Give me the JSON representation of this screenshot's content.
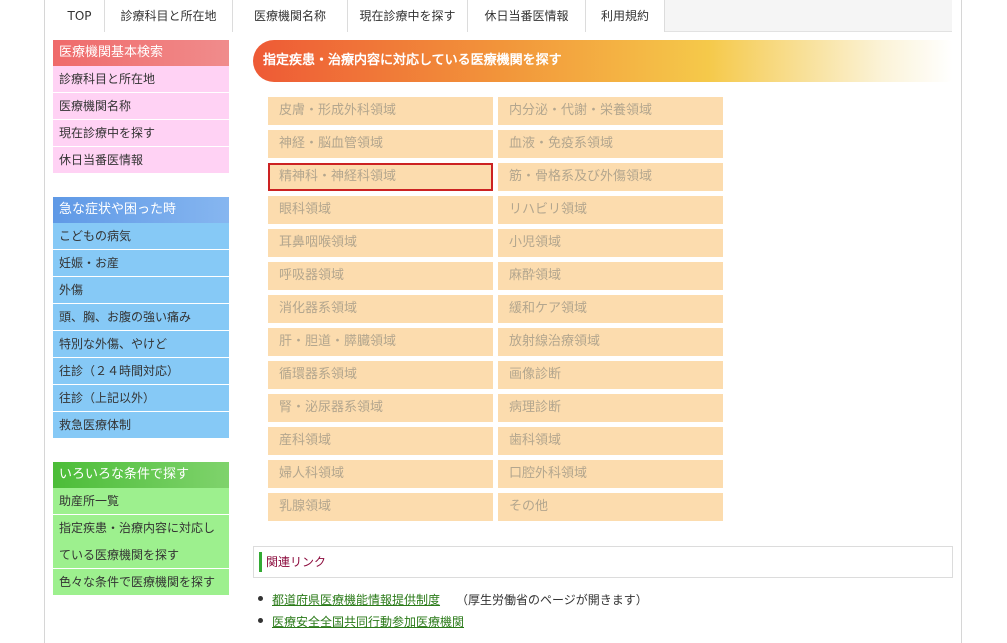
{
  "topnav": {
    "items": [
      "TOP",
      "診療科目と所在地",
      "医療機関名称",
      "現在診療中を探す",
      "休日当番医情報",
      "利用規約"
    ]
  },
  "sidebar": {
    "basic": {
      "title": "医療機関基本検索",
      "items": [
        "診療科目と所在地",
        "医療機関名称",
        "現在診療中を探す",
        "休日当番医情報"
      ]
    },
    "emergency": {
      "title": "急な症状や困った時",
      "items": [
        "こどもの病気",
        "妊娠・お産",
        "外傷",
        "頭、胸、お腹の強い痛み",
        "特別な外傷、やけど",
        "往診（２４時間対応）",
        "往診（上記以外）",
        "救急医療体制"
      ]
    },
    "conditions": {
      "title": "いろいろな条件で探す",
      "items": [
        "助産所一覧",
        "指定疾患・治療内容に対応している医療機関を探す",
        "色々な条件で医療機関を探す"
      ]
    }
  },
  "main": {
    "banner_title": "指定疾患・治療内容に対応している医療機関を探す",
    "categories": [
      "皮膚・形成外科領域",
      "内分泌・代謝・栄養領域",
      "神経・脳血管領域",
      "血液・免疫系領域",
      "精神科・神経科領域",
      "筋・骨格系及び外傷領域",
      "眼科領域",
      "リハビリ領域",
      "耳鼻咽喉領域",
      "小児領域",
      "呼吸器領域",
      "麻酔領域",
      "消化器系領域",
      "緩和ケア領域",
      "肝・胆道・膵臓領域",
      "放射線治療領域",
      "循環器系領域",
      "画像診断",
      "腎・泌尿器系領域",
      "病理診断",
      "産科領域",
      "歯科領域",
      "婦人科領域",
      "口腔外科領域",
      "乳腺領域",
      "その他"
    ],
    "selected_index": 4,
    "related_title": "関連リンク",
    "links": [
      {
        "text": "都道府県医療機能情報提供制度",
        "note": "（厚生労働省のページが開きます）"
      },
      {
        "text": "医療安全全国共同行動参加医療機関",
        "note": ""
      }
    ]
  },
  "colors": {
    "accent_red": "#cc2222",
    "category_bg": "#fcdcae",
    "link_green": "#2a7a18"
  }
}
